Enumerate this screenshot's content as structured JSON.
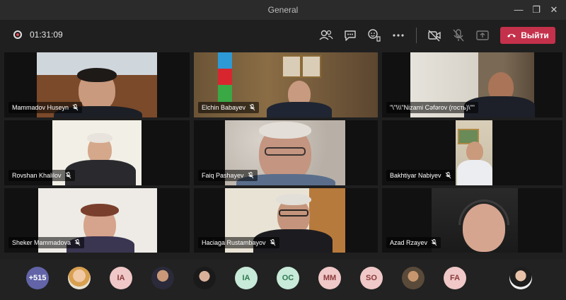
{
  "window": {
    "title": "General"
  },
  "toolbar": {
    "timer": "01:31:09",
    "leave_label": "Выйти"
  },
  "tiles": [
    {
      "name": "Mammadov Huseyn"
    },
    {
      "name": "Elchin Babayev"
    },
    {
      "name": "\"\\\"\\\\\\\"Nizami Cəfərov (гость)\\\"\""
    },
    {
      "name": "Rovshan Khalilov"
    },
    {
      "name": "Faiq Pashayev"
    },
    {
      "name": "Bakhtiyar Nabiyev"
    },
    {
      "name": "Sheker Mammadova"
    },
    {
      "name": "Haciaga Rustambayov"
    },
    {
      "name": "Azad Rzayev"
    }
  ],
  "roster": {
    "more_count": "+515",
    "initials": [
      "IA",
      "IA",
      "OC",
      "MM",
      "SO",
      "FA"
    ]
  },
  "colors": {
    "accent": "#6264a7",
    "leave": "#c4314b",
    "recording": "#e74856"
  }
}
